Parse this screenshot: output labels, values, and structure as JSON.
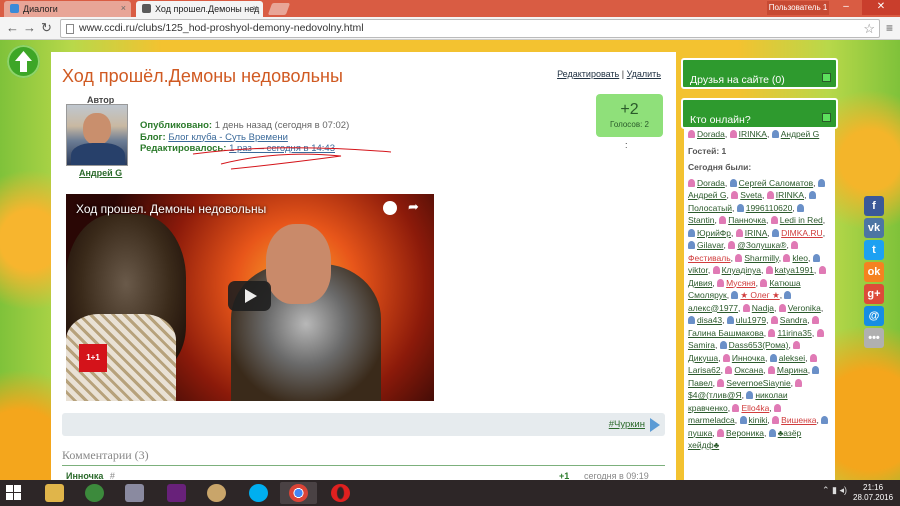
{
  "browser": {
    "tabs": [
      {
        "label": "Диалоги",
        "close": "×"
      },
      {
        "label": "Ход прошел.Демоны нед",
        "close": "×"
      }
    ],
    "user_badge": "Пользователь 1",
    "url": "www.ccdi.ru/clubs/125_hod-proshyol-demony-nedovolny.html"
  },
  "post": {
    "title": "Ход прошёл.Демоны недовольны",
    "edit_label": "Редактировать",
    "separator": "|",
    "delete_label": "Удалить",
    "author_label": "Автор",
    "author_name": "Андрей G",
    "published_label": "Опубликовано:",
    "published_value": "1 день назад (сегодня в 07:02)",
    "blog_label": "Блог:",
    "blog_value": "Блог клуба - Суть Времени",
    "edited_label": "Редактировалось:",
    "edited_value": "1 раз — сегодня в 14:43",
    "vote_score": "+2",
    "vote_count": "Голосов: 2",
    "vote_dot": ":"
  },
  "video": {
    "title": "Ход прошел. Демоны недовольны",
    "mic_label": "1+1"
  },
  "tags": {
    "tag": "#Чуркин"
  },
  "comments": {
    "title": "Комментарии (3)",
    "first": {
      "author": "Инночка",
      "hash": "#",
      "score": "+1",
      "time": "сегодня в 09:19"
    }
  },
  "sidebar": {
    "friends_title": "Друзья на сайте (0)",
    "online_title": "Кто онлайн?",
    "online_users": [
      {
        "name": "Dorada",
        "g": "f"
      },
      {
        "name": "IRINKA",
        "g": "f"
      },
      {
        "name": "Андрей G",
        "g": "m"
      }
    ],
    "guests": "Гостей: 1",
    "today_title": "Сегодня были:",
    "today_users": [
      {
        "name": "Dorada",
        "g": "f"
      },
      {
        "name": "Сергей Саломатов",
        "g": "m"
      },
      {
        "name": "Андрей G",
        "g": "m"
      },
      {
        "name": "Sveta",
        "g": "f"
      },
      {
        "name": "IRINKA",
        "g": "f"
      },
      {
        "name": "Полосатый",
        "g": "m"
      },
      {
        "name": "1996110620",
        "g": "m"
      },
      {
        "name": "Stantin",
        "g": "m"
      },
      {
        "name": "Панночка",
        "g": "f"
      },
      {
        "name": "Ledi in Red",
        "g": "f"
      },
      {
        "name": "ЮрийФр",
        "g": "m"
      },
      {
        "name": "IRINA",
        "g": "f"
      },
      {
        "name": "DIMKA.RU",
        "g": "m",
        "red": true
      },
      {
        "name": "Gilavar",
        "g": "m"
      },
      {
        "name": "@Золушка®",
        "g": "f"
      },
      {
        "name": "Фестиваль",
        "g": "f",
        "red": true
      },
      {
        "name": "Sharmilly",
        "g": "f"
      },
      {
        "name": "kleo",
        "g": "f"
      },
      {
        "name": "viktor",
        "g": "m"
      },
      {
        "name": "Клуадinya",
        "g": "f"
      },
      {
        "name": "katya1991",
        "g": "f"
      },
      {
        "name": "Дивия",
        "g": "f"
      },
      {
        "name": "Мусяня",
        "g": "f",
        "red": true
      },
      {
        "name": "Катюша Смолярук",
        "g": "f"
      },
      {
        "name": "★ Олег ★",
        "g": "m",
        "red": true
      },
      {
        "name": "алекс@1977",
        "g": "m"
      },
      {
        "name": "Nadja",
        "g": "f"
      },
      {
        "name": "Veronika",
        "g": "f"
      },
      {
        "name": "disa43",
        "g": "m"
      },
      {
        "name": "ulu1979",
        "g": "m"
      },
      {
        "name": "Sandra",
        "g": "f"
      },
      {
        "name": "Галина Башмакова",
        "g": "f"
      },
      {
        "name": "11irina35",
        "g": "f"
      },
      {
        "name": "Samira",
        "g": "f"
      },
      {
        "name": "Dass653(Рома)",
        "g": "m"
      },
      {
        "name": "Дикуша",
        "g": "f"
      },
      {
        "name": "Инночка",
        "g": "f"
      },
      {
        "name": "aleksei",
        "g": "m"
      },
      {
        "name": "Larisa62",
        "g": "f"
      },
      {
        "name": "Оксана",
        "g": "f"
      },
      {
        "name": "Марина",
        "g": "f"
      },
      {
        "name": "Павел",
        "g": "m"
      },
      {
        "name": "SevernoeSiaynie",
        "g": "f"
      },
      {
        "name": "$4@(тлив@Я",
        "g": "f"
      },
      {
        "name": "николаи кравченко",
        "g": "m"
      },
      {
        "name": "Ello4ka",
        "g": "f",
        "red": true
      },
      {
        "name": "marmeladca",
        "g": "f"
      },
      {
        "name": "kiniki",
        "g": "m"
      },
      {
        "name": "Вишенка",
        "g": "f",
        "red": true
      },
      {
        "name": "пушка",
        "g": "m"
      },
      {
        "name": "Вероника",
        "g": "f"
      },
      {
        "name": "♣азёр хейдф♣",
        "g": "m"
      }
    ]
  },
  "social": [
    {
      "icon": "facebook-icon",
      "glyph": "f",
      "color": "#3b5998"
    },
    {
      "icon": "vk-icon",
      "glyph": "vk",
      "color": "#4c75a3"
    },
    {
      "icon": "twitter-icon",
      "glyph": "t",
      "color": "#1da1f2"
    },
    {
      "icon": "odnoklassniki-icon",
      "glyph": "ok",
      "color": "#f58220"
    },
    {
      "icon": "google-plus-icon",
      "glyph": "g+",
      "color": "#dd4b39"
    },
    {
      "icon": "mail-icon",
      "glyph": "@",
      "color": "#168de2"
    },
    {
      "icon": "more-icon",
      "glyph": "•••",
      "color": "#b0b0b0"
    }
  ],
  "taskbar": {
    "time": "21:16",
    "date": "28.07.2016"
  }
}
